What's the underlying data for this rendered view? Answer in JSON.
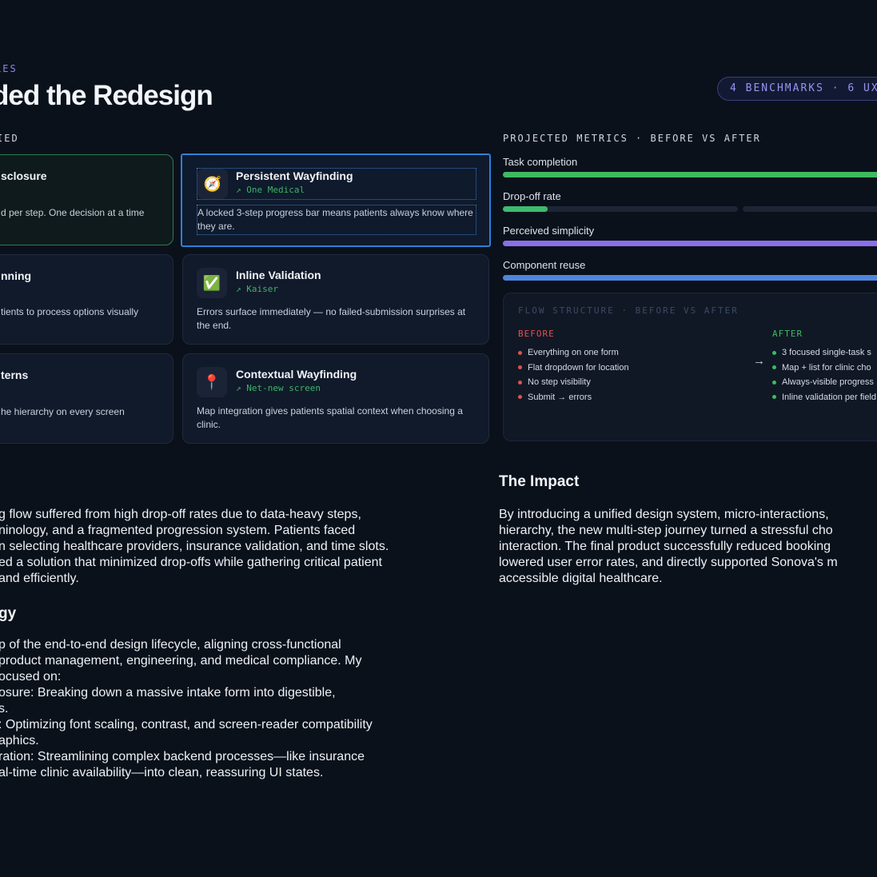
{
  "header": {
    "eyebrow": "LES",
    "title": "ded the Redesign",
    "pill": "4 BENCHMARKS · 6 UX P"
  },
  "left_section": {
    "label": "IED"
  },
  "cards": [
    {
      "id": "disclosure",
      "title": "sclosure",
      "desc": "d per step. One decision at a time"
    },
    {
      "id": "persistent",
      "icon": "compass-icon",
      "glyph": "🧭",
      "title": "Persistent Wayfinding",
      "sub": "↗ One Medical",
      "desc": "A locked 3-step progress bar means patients always know where they are."
    },
    {
      "id": "scanning",
      "title": "nning",
      "desc": "tients to process options visually"
    },
    {
      "id": "inline",
      "icon": "checkmark-icon",
      "glyph": "✅",
      "title": "Inline Validation",
      "sub": "↗ Kaiser",
      "desc": "Errors surface immediately — no failed-submission surprises at the end."
    },
    {
      "id": "patterns",
      "title": "terns",
      "desc": "he hierarchy on every screen"
    },
    {
      "id": "contextual",
      "icon": "map-pin-icon",
      "glyph": "📍",
      "title": "Contextual Wayfinding",
      "sub": "↗ Net-new screen",
      "desc": "Map integration gives patients spatial context when choosing a clinic."
    }
  ],
  "metrics": {
    "label": "PROJECTED METRICS · BEFORE VS AFTER",
    "items": [
      {
        "name": "Task completion",
        "value": 1.0,
        "color": "#3dbb5e"
      },
      {
        "name": "Drop-off rate",
        "value": 0.19,
        "color": "#3dbb6e"
      },
      {
        "name": "Perceived simplicity",
        "value": 1.0,
        "color": "#8a6fe8"
      },
      {
        "name": "Component reuse",
        "value": 1.0,
        "color": "#4f86dc"
      }
    ]
  },
  "flow": {
    "title": "FLOW STRUCTURE · BEFORE VS AFTER",
    "before_label": "BEFORE",
    "after_label": "AFTER",
    "arrow": "→",
    "before": [
      "Everything on one form",
      "Flat dropdown for location",
      "No step visibility",
      "Submit → errors"
    ],
    "after": [
      "3 focused single-task s",
      "Map + list for clinic cho",
      "Always-visible progress",
      "Inline validation per field"
    ]
  },
  "left_text": {
    "para1": "g flow suffered from high drop-off rates due to data-heavy steps,\nninology, and a fragmented progression system. Patients faced\nn selecting healthcare providers, insurance validation, and time slots.\ned a solution that minimized drop-offs while gathering critical patient\nand efficiently.",
    "heading2": "gy",
    "para2": "p of the end-to-end design lifecycle, aligning cross-functional\nproduct management, engineering, and medical compliance. My\nocused on:\nosure: Breaking down a massive intake form into digestible,\ns.\n: Optimizing font scaling, contrast, and screen-reader compatibility\naphics.\nration: Streamlining complex backend processes—like insurance\nal-time clinic availability—into clean, reassuring UI states."
  },
  "impact": {
    "heading": "The Impact",
    "para": "By introducing a unified design system, micro-interactions,\nhierarchy, the new multi-step journey turned a stressful cho\ninteraction. The final product successfully reduced booking\nlowered user error rates, and directly supported Sonova's m\naccessible digital healthcare."
  }
}
